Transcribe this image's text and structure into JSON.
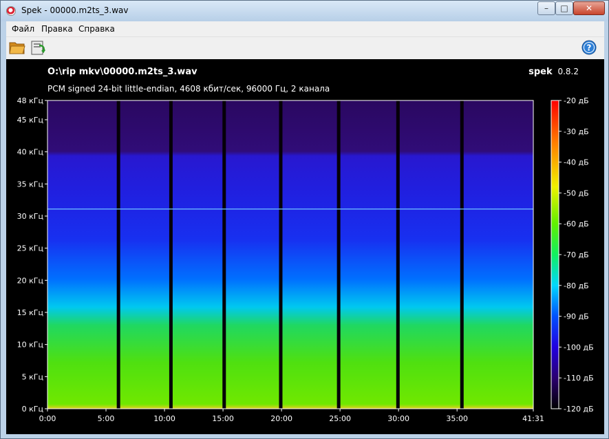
{
  "window": {
    "title": "Spek - 00000.m2ts_3.wav",
    "min_glyph": "–",
    "max_glyph": "□",
    "close_glyph": "✕"
  },
  "menu": {
    "items": [
      "Файл",
      "Правка",
      "Справка"
    ]
  },
  "toolbar": {
    "open_icon": "folder-open-icon",
    "save_icon": "save-export-icon",
    "help_icon": "help-icon"
  },
  "file": {
    "path": "O:\\rip mkv\\00000.m2ts_3.wav",
    "info": "PCM signed 24-bit little-endian, 4608 кбит/сек, 96000 Гц, 2 канала"
  },
  "brand": {
    "name": "spek",
    "version": "0.8.2"
  },
  "chart_data": {
    "type": "heatmap",
    "title": "O:\\rip mkv\\00000.m2ts_3.wav",
    "subtitle": "PCM signed 24-bit little-endian, 4608 кбит/сек, 96000 Гц, 2 канала",
    "x_ticks": [
      "0:00",
      "5:00",
      "10:00",
      "15:00",
      "20:00",
      "25:00",
      "30:00",
      "35:00",
      "41:31"
    ],
    "x_tick_seconds": [
      0,
      300,
      600,
      900,
      1200,
      1500,
      1800,
      2100,
      2491
    ],
    "xlim_seconds": [
      0,
      2491
    ],
    "y_ticks": [
      "0 кГц",
      "5 кГц",
      "10 кГц",
      "15 кГц",
      "20 кГц",
      "25 кГц",
      "30 кГц",
      "35 кГц",
      "40 кГц",
      "45 кГц",
      "48 кГц"
    ],
    "y_tick_khz": [
      0,
      5,
      10,
      15,
      20,
      25,
      30,
      35,
      40,
      45,
      48
    ],
    "ylim_khz": [
      0,
      48
    ],
    "colorbar_ticks": [
      "-20 дБ",
      "-30 дБ",
      "-40 дБ",
      "-50 дБ",
      "-60 дБ",
      "-70 дБ",
      "-80 дБ",
      "-90 дБ",
      "-100 дБ",
      "-110 дБ",
      "-120 дБ"
    ],
    "colorbar_db": [
      -20,
      -30,
      -40,
      -50,
      -60,
      -70,
      -80,
      -90,
      -100,
      -110,
      -120
    ],
    "colorbar_range_db": [
      -120,
      -20
    ],
    "colorbar_colors": [
      "#000000",
      "#2a0070",
      "#2000e0",
      "#0050ff",
      "#00d8ff",
      "#10f060",
      "#60f000",
      "#f0f000",
      "#ff8000",
      "#ff0000"
    ],
    "silence_gaps_seconds": [
      364,
      633,
      906,
      1196,
      1493,
      1797,
      2125
    ],
    "tone_line_khz": 31.1,
    "high_band_khz": 40,
    "description_energy_note": "green (-60..-70 дБ) below ~15 кГц, cyan ~15-20 кГц, blue above"
  }
}
